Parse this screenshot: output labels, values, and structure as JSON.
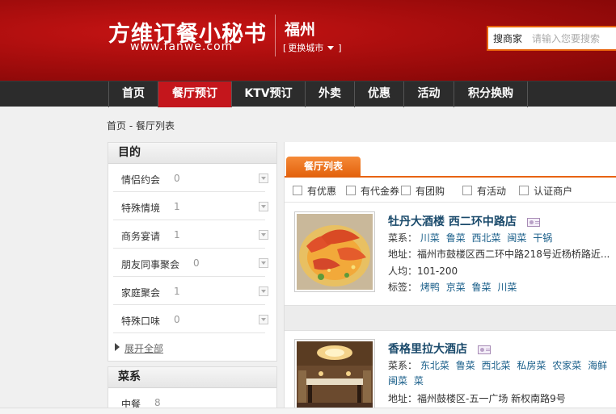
{
  "header": {
    "logo_cn": "方维订餐小秘书",
    "logo_en": "www.fanwe.com",
    "city": "福州",
    "change_city": "更换城市",
    "search_type": "搜商家",
    "search_placeholder": "请输入您要搜索"
  },
  "nav": {
    "items": [
      "首页",
      "餐厅预订",
      "KTV预订",
      "外卖",
      "优惠",
      "活动",
      "积分换购"
    ],
    "active_index": 1
  },
  "breadcrumb": "首页 - 餐厅列表",
  "sidebar": {
    "purpose_title": "目的",
    "purpose_items": [
      {
        "label": "情侣约会",
        "count": "0"
      },
      {
        "label": "特殊情境",
        "count": "1"
      },
      {
        "label": "商务宴请",
        "count": "1"
      },
      {
        "label": "朋友同事聚会",
        "count": "0"
      },
      {
        "label": "家庭聚会",
        "count": "1"
      },
      {
        "label": "特殊口味",
        "count": "0"
      }
    ],
    "expand_all": "展开全部",
    "cuisine_title": "菜系",
    "cuisine_items": [
      {
        "label": "中餐",
        "count": "8"
      }
    ]
  },
  "main": {
    "tab": "餐厅列表",
    "filters": [
      "有优惠",
      "有代金券",
      "有团购",
      "有活动",
      "认证商户"
    ],
    "restaurants": [
      {
        "name": "牡丹大酒楼  西二环中路店",
        "cuisine_label": "菜系：",
        "cuisines": [
          "川菜",
          "鲁菜",
          "西北菜",
          "闽菜",
          "干锅"
        ],
        "address": "地址：福州市鼓楼区西二环中路218号近杨桥路近...",
        "price": "人均：101-200",
        "tags_label": "标签：",
        "tags": [
          "烤鸭",
          "京菜",
          "鲁菜",
          "川菜"
        ]
      },
      {
        "name": "香格里拉大酒店",
        "cuisine_label": "菜系：",
        "cuisines": [
          "东北菜",
          "鲁菜",
          "西北菜",
          "私房菜",
          "农家菜",
          "海鲜",
          "闽菜",
          "菜"
        ],
        "address": "地址：福州鼓楼区-五一广场  新权南路9号"
      }
    ]
  },
  "colors": {
    "header_red": "#a70d0d",
    "nav_dark": "#2c2c2c",
    "nav_active": "#c4161c",
    "accent_orange": "#e8630a",
    "link_blue": "#1a5f8a"
  }
}
